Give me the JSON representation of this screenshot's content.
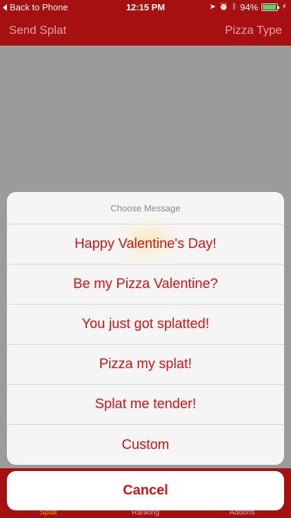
{
  "status_bar": {
    "back_label": "Back to Phone",
    "time": "12:15 PM",
    "battery_percent": "94%",
    "battery_level": 0.94,
    "icons": [
      "location-arrow-icon",
      "alarm-icon",
      "bluetooth-icon",
      "battery-icon",
      "charging-icon"
    ]
  },
  "nav_bar": {
    "left_label": "Send Splat",
    "right_label": "Pizza Type"
  },
  "action_sheet": {
    "title": "Choose Message",
    "options": [
      "Happy Valentine's Day!",
      "Be my Pizza Valentine?",
      "You just got splatted!",
      "Pizza my splat!",
      "Splat me tender!",
      "Custom"
    ],
    "cancel_label": "Cancel"
  },
  "tab_bar": {
    "items": [
      "Splat",
      "Ranking",
      "Addons"
    ]
  },
  "colors": {
    "brand_red": "#a61010",
    "action_red": "#d91414",
    "active_tab": "#d8a200"
  }
}
